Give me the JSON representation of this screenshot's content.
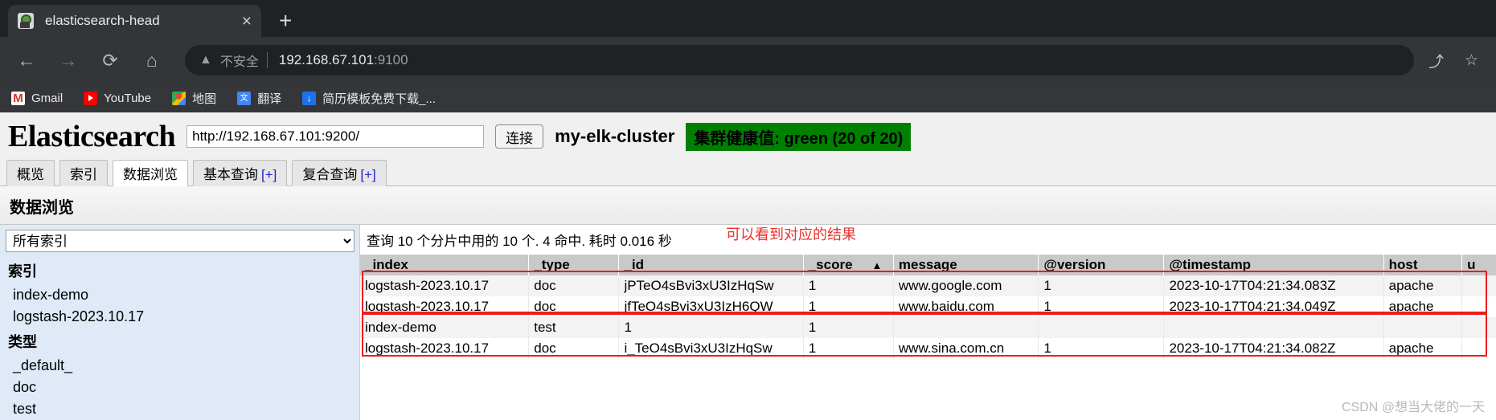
{
  "browser": {
    "tab": {
      "title": "elasticsearch-head",
      "close_label": "×",
      "favicon": "elasticsearch-head-favicon"
    },
    "new_tab_label": "+",
    "nav": {
      "back": "←",
      "forward": "→",
      "reload": "⟳",
      "home": "⌂"
    },
    "omnibox": {
      "warning_icon": "warning-triangle-icon",
      "security_label": "不安全",
      "url_host": "192.168.67.101",
      "url_port": ":9100"
    },
    "toolbar_right": {
      "share": "⤴",
      "bookmark_star": "☆"
    },
    "bookmarks": [
      {
        "label": "Gmail",
        "icon": "gmail-icon"
      },
      {
        "label": "YouTube",
        "icon": "youtube-icon"
      },
      {
        "label": "地图",
        "icon": "google-maps-icon"
      },
      {
        "label": "翻译",
        "icon": "google-translate-icon"
      },
      {
        "label": "简历模板免费下载_...",
        "icon": "download-icon"
      }
    ]
  },
  "app": {
    "brand": "Elasticsearch",
    "es_url": "http://192.168.67.101:9200/",
    "connect_button": "连接",
    "cluster_name": "my-elk-cluster",
    "health_badge": "集群健康值: green (20 of 20)",
    "health_color": "#008000",
    "tabs": [
      {
        "label": "概览",
        "active": false
      },
      {
        "label": "索引",
        "active": false
      },
      {
        "label": "数据浏览",
        "active": true
      },
      {
        "label": "基本查询",
        "plus": "[+]",
        "active": false
      },
      {
        "label": "复合查询",
        "plus": "[+]",
        "active": false
      }
    ],
    "section_title": "数据浏览"
  },
  "sidebar": {
    "index_select_value": "所有索引",
    "groups": [
      {
        "heading": "索引",
        "items": [
          "index-demo",
          "logstash-2023.10.17"
        ]
      },
      {
        "heading": "类型",
        "items": [
          "_default_",
          "doc",
          "test"
        ]
      }
    ]
  },
  "main": {
    "annotation": "可以看到对应的结果",
    "annotation_color": "#e8312a",
    "query_info": "查询 10 个分片中用的 10 个. 4 命中. 耗时 0.016 秒",
    "columns": [
      "_index",
      "_type",
      "_id",
      "_score",
      "message",
      "@version",
      "@timestamp",
      "host",
      "u"
    ],
    "sorted_column": "_score",
    "sort_arrow": "▲",
    "rows": [
      {
        "_index": "logstash-2023.10.17",
        "_type": "doc",
        "_id": "jPTeO4sBvi3xU3IzHqSw",
        "_score": "1",
        "message": "www.google.com",
        "@version": "1",
        "@timestamp": "2023-10-17T04:21:34.083Z",
        "host": "apache",
        "extra": ""
      },
      {
        "_index": "logstash-2023.10.17",
        "_type": "doc",
        "_id": "jfTeO4sBvi3xU3IzH6QW",
        "_score": "1",
        "message": "www.baidu.com",
        "@version": "1",
        "@timestamp": "2023-10-17T04:21:34.049Z",
        "host": "apache",
        "extra": ""
      },
      {
        "_index": "index-demo",
        "_type": "test",
        "_id": "1",
        "_score": "1",
        "message": "",
        "@version": "",
        "@timestamp": "",
        "host": "",
        "extra": ""
      },
      {
        "_index": "logstash-2023.10.17",
        "_type": "doc",
        "_id": "i_TeO4sBvi3xU3IzHqSw",
        "_score": "1",
        "message": "www.sina.com.cn",
        "@version": "1",
        "@timestamp": "2023-10-17T04:21:34.082Z",
        "host": "apache",
        "extra": ""
      }
    ],
    "watermark": "CSDN @想当大佬的一天"
  }
}
